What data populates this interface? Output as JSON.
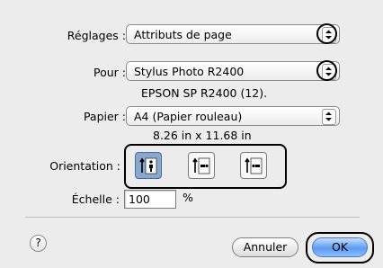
{
  "settings": {
    "label": "Réglages :",
    "value": "Attributs de page"
  },
  "format_for": {
    "label": "Pour :",
    "value": "Stylus Photo R2400",
    "description": "EPSON SP R2400 (12)."
  },
  "paper": {
    "label": "Papier :",
    "value": "A4 (Papier rouleau)",
    "dimensions": "8.26 in x 11.68 in"
  },
  "orientation": {
    "label": "Orientation :",
    "options": [
      {
        "name": "portrait",
        "selected": true
      },
      {
        "name": "landscape-left",
        "selected": false
      },
      {
        "name": "landscape-right",
        "selected": false
      }
    ]
  },
  "scale": {
    "label": "Échelle :",
    "value": "100",
    "unit": "%"
  },
  "buttons": {
    "help": "?",
    "cancel": "Annuler",
    "ok": "OK"
  },
  "icons": {
    "popup_arrows": "up-down-arrows-icon",
    "help": "question-icon"
  },
  "colors": {
    "selected_orientation": "#8aa7d0",
    "default_button": "#5b9bf0"
  }
}
